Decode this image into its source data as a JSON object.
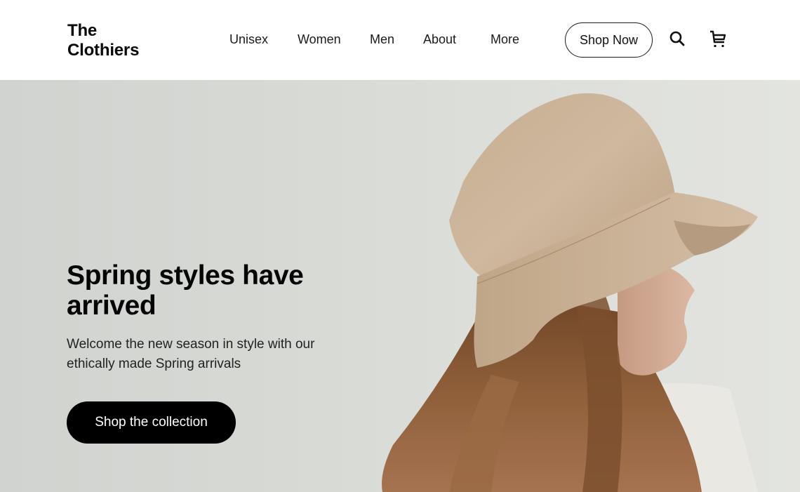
{
  "header": {
    "logo_line1": "The",
    "logo_line2": "Clothiers",
    "nav": [
      {
        "label": "Unisex"
      },
      {
        "label": "Women"
      },
      {
        "label": "Men"
      },
      {
        "label": "About"
      },
      {
        "label": "More"
      }
    ],
    "shop_now_label": "Shop Now",
    "icons": {
      "search": "search-icon",
      "cart": "cart-icon"
    }
  },
  "hero": {
    "title": "Spring styles have arrived",
    "subtitle": "Welcome the new season in style with our ethically made Spring arrivals",
    "cta_label": "Shop the collection",
    "image_alt": "Woman wearing a beige linen bucket hat"
  },
  "colors": {
    "brand_text": "#0a0a0a",
    "cta_background": "#000000",
    "cta_text": "#ffffff",
    "hero_background": "#d6d8d4",
    "hat": "#c9b299",
    "hair": "#8a5a36"
  }
}
